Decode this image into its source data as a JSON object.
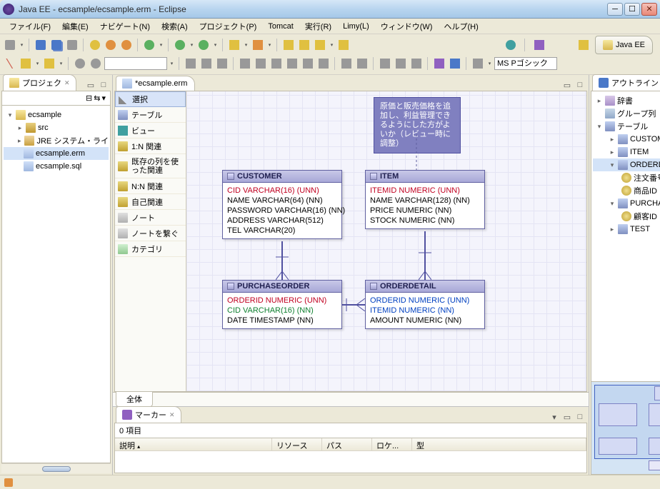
{
  "window": {
    "title": "Java EE - ecsample/ecsample.erm - Eclipse",
    "perspective": "Java EE"
  },
  "menu": {
    "file": "ファイル(F)",
    "edit": "編集(E)",
    "navigate": "ナビゲート(N)",
    "search": "検索(A)",
    "project": "プロジェクト(P)",
    "tomcat": "Tomcat",
    "run": "実行(R)",
    "limy": "Limy(L)",
    "window": "ウィンドウ(W)",
    "help": "ヘルプ(H)"
  },
  "toolbar": {
    "font_name": "MS Pゴシック"
  },
  "project_view": {
    "title": "プロジェク",
    "root": "ecsample",
    "src": "src",
    "jre": "JRE システム・ライ",
    "erm": "ecsample.erm",
    "sql": "ecsample.sql"
  },
  "editor": {
    "tab": "*ecsample.erm",
    "footer_tab": "全体"
  },
  "palette": {
    "select": "選択",
    "table": "テーブル",
    "view": "ビュー",
    "rel_1n": "1:N 関連",
    "rel_reuse": "既存の列を使った関連",
    "rel_nn": "N:N 関連",
    "rel_self": "自己関連",
    "note": "ノート",
    "note_link": "ノートを繋ぐ",
    "category": "カテゴリ"
  },
  "sticky": {
    "text": "原価と販売価格を追加し、利益管理できるようにした方がよいか（レビュー時に調整）"
  },
  "entities": {
    "customer": {
      "name": "CUSTOMER",
      "cols": [
        {
          "t": "CID VARCHAR(16) (UNN)",
          "c": "pk"
        },
        {
          "t": "NAME VARCHAR(64) (NN)",
          "c": ""
        },
        {
          "t": "PASSWORD VARCHAR(16) (NN)",
          "c": ""
        },
        {
          "t": "ADDRESS VARCHAR(512)",
          "c": ""
        },
        {
          "t": "TEL VARCHAR(20)",
          "c": ""
        }
      ]
    },
    "item": {
      "name": "ITEM",
      "cols": [
        {
          "t": "ITEMID NUMERIC (UNN)",
          "c": "pk"
        },
        {
          "t": "NAME VARCHAR(128) (NN)",
          "c": ""
        },
        {
          "t": "PRICE NUMERIC (NN)",
          "c": ""
        },
        {
          "t": "STOCK NUMERIC (NN)",
          "c": ""
        }
      ]
    },
    "purchaseorder": {
      "name": "PURCHASEORDER",
      "cols": [
        {
          "t": "ORDERID NUMERIC (UNN)",
          "c": "pk"
        },
        {
          "t": "CID VARCHAR(16) (NN)",
          "c": "ck"
        },
        {
          "t": "DATE TIMESTAMP (NN)",
          "c": ""
        }
      ]
    },
    "orderdetail": {
      "name": "ORDERDETAIL",
      "cols": [
        {
          "t": "ORDERID NUMERIC (UNN)",
          "c": "fk"
        },
        {
          "t": "ITEMID NUMERIC (NN)",
          "c": "fk"
        },
        {
          "t": "AMOUNT NUMERIC (NN)",
          "c": ""
        }
      ]
    }
  },
  "outline": {
    "title": "アウトライン",
    "dict": "辞書",
    "groups": "グループ列",
    "tables": "テーブル",
    "customer": "CUSTOMER",
    "item": "ITEM",
    "orderdetail": "ORDERDETAIL",
    "od_orderno": "注文番号",
    "od_itemid": "商品ID",
    "purchaseorder": "PURCHASEORDER",
    "po_cid": "顧客ID",
    "test": "TEST"
  },
  "markers": {
    "title": "マーカー",
    "count": "0 項目",
    "col_desc": "説明",
    "col_resource": "リソース",
    "col_path": "パス",
    "col_location": "ロケ...",
    "col_type": "型"
  }
}
